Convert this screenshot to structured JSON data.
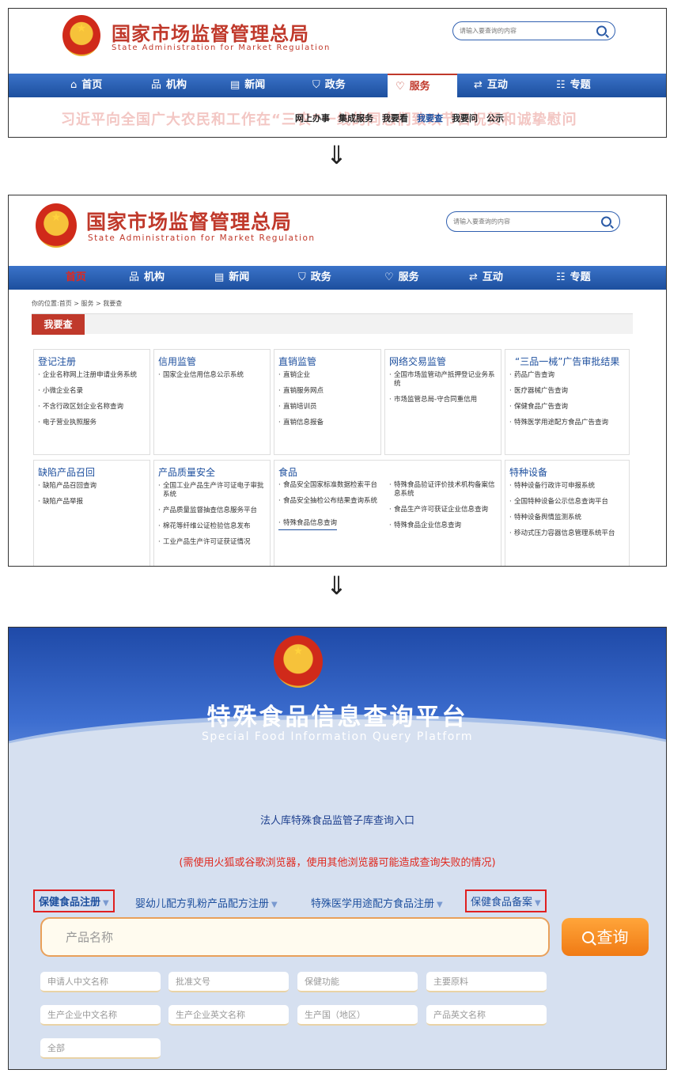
{
  "site": {
    "name_cn": "国家市场监督管理总局",
    "name_en": "State Administration for Market Regulation",
    "search_placeholder": "请输入要查询的内容"
  },
  "nav": [
    "首页",
    "机构",
    "新闻",
    "政务",
    "服务",
    "互动",
    "专题"
  ],
  "panel1": {
    "ghost_headline": "习近平向全国广大农民和工作在“三农”一线的同志们致以节日祝贺和诚挚慰问",
    "subnav": [
      "网上办事",
      "集成服务",
      "我要看",
      "我要查",
      "我要问",
      "公示"
    ]
  },
  "panel2": {
    "breadcrumb": "你的位置:首页 > 服务 > 我要查",
    "section_title": "我要查",
    "cards": [
      {
        "title": "登记注册",
        "items": [
          "企业名称网上注册申请业务系统",
          "小微企业名录",
          "不含行政区划企业名称查询",
          "电子营业执照服务"
        ]
      },
      {
        "title": "信用监管",
        "items": [
          "国家企业信用信息公示系统"
        ]
      },
      {
        "title": "直销监管",
        "items": [
          "直销企业",
          "直销服务网点",
          "直销培训员",
          "直销信息报备"
        ]
      },
      {
        "title": "网络交易监管",
        "items": [
          "全国市场监管动产抵押登记业务系统",
          "市场监管总局-守合同重信用"
        ]
      },
      {
        "title": "“三品一械”广告审批结果",
        "items": [
          "药品广告查询",
          "医疗器械广告查询",
          "保健食品广告查询",
          "特殊医学用途配方食品广告查询"
        ]
      },
      {
        "title": "缺陷产品召回",
        "items": [
          "缺陷产品召回查询",
          "缺陷产品举报"
        ]
      },
      {
        "title": "产品质量安全",
        "items": [
          "全国工业产品生产许可证电子审批系统",
          "产品质量监督抽查信息服务平台",
          "棉花等纤维公证检验信息发布",
          "工业产品生产许可证获证情况"
        ]
      },
      {
        "title": "食品",
        "items": [
          "食品安全国家标准数据检索平台",
          "食品安全抽检公布结果查询系统",
          "特殊食品信息查询"
        ],
        "items2": [
          "特殊食品验证评价技术机构备案信息系统",
          "食品生产许可获证企业信息查询",
          "特殊食品企业信息查询"
        ]
      },
      {
        "title": "特种设备",
        "items": [
          "特种设备行政许可申报系统",
          "全国特种设备公示信息查询平台",
          "特种设备舆情监测系统",
          "移动式压力容器信息管理系统平台"
        ]
      }
    ]
  },
  "panel3": {
    "title": "特殊食品信息查询平台",
    "subtitle": "Special Food Information Query Platform",
    "entry": "法人库特殊食品监管子库查询入口",
    "note": "(需使用火狐或谷歌浏览器，使用其他浏览器可能造成查询失败的情况)",
    "tabs": [
      "保健食品注册",
      "婴幼儿配方乳粉产品配方注册",
      "特殊医学用途配方食品注册",
      "保健食品备案"
    ],
    "main_placeholder": "产品名称",
    "query_label": "查询",
    "fields": [
      "申请人中文名称",
      "批准文号",
      "保健功能",
      "主要原料",
      "生产企业中文名称",
      "生产企业英文名称",
      "生产国（地区）",
      "产品英文名称",
      "全部"
    ]
  },
  "colors": {
    "brand_red": "#c0392b",
    "nav_blue": "#1d4f9e",
    "query_orange": "#f07a14",
    "highlight_box": "#e02020"
  }
}
